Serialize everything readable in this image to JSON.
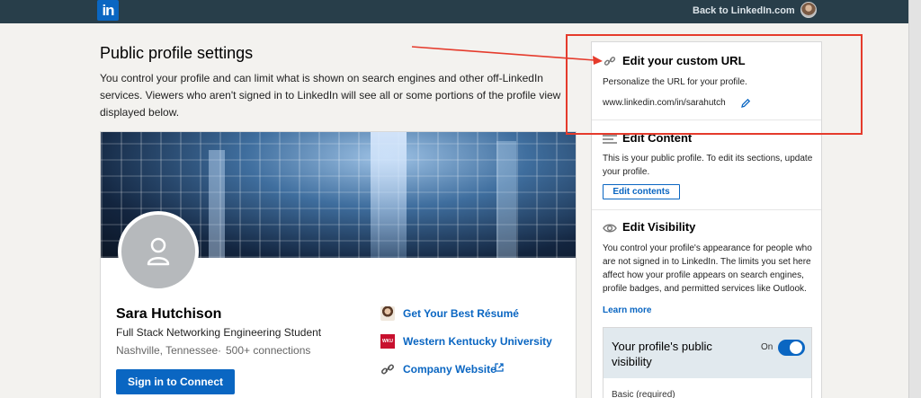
{
  "topbar": {
    "logo_text": "in",
    "back_link": "Back to LinkedIn.com"
  },
  "header": {
    "title": "Public profile settings",
    "description": "You control your profile and can limit what is shown on search engines and other off-LinkedIn services. Viewers who aren't signed in to LinkedIn will see all or some portions of the profile view displayed below."
  },
  "profile": {
    "name": "Sara Hutchison",
    "headline": "Full Stack Networking Engineering Student",
    "location": "Nashville, Tennessee",
    "separator": "·",
    "connections": "500+ connections",
    "connect_button": "Sign in to Connect",
    "links": [
      {
        "label": "Get Your Best Résumé",
        "icon": "resume-photo-icon"
      },
      {
        "label": "Western Kentucky University",
        "icon": "wku-logo-icon",
        "icon_text": "WKU"
      },
      {
        "label": "Company Website",
        "icon": "link-icon"
      }
    ]
  },
  "right_panel": {
    "custom_url": {
      "title": "Edit your custom URL",
      "description": "Personalize the URL for your profile.",
      "url": "www.linkedin.com/in/sarahutch"
    },
    "edit_content": {
      "title": "Edit Content",
      "description": "This is your public profile. To edit its sections, update your profile.",
      "button": "Edit contents"
    },
    "edit_visibility": {
      "title": "Edit Visibility",
      "description": "You control your profile's appearance for people who are not signed in to LinkedIn. The limits you set here affect how your profile appears on search engines, profile badges, and permitted services like Outlook.",
      "learn_more": "Learn more",
      "public_visibility_label": "Your profile's public visibility",
      "toggle_state": "On",
      "basic_label": "Basic (required)"
    }
  },
  "colors": {
    "brand": "#0a66c2",
    "topbar": "#283e4a",
    "annotation": "#e53b2c"
  }
}
